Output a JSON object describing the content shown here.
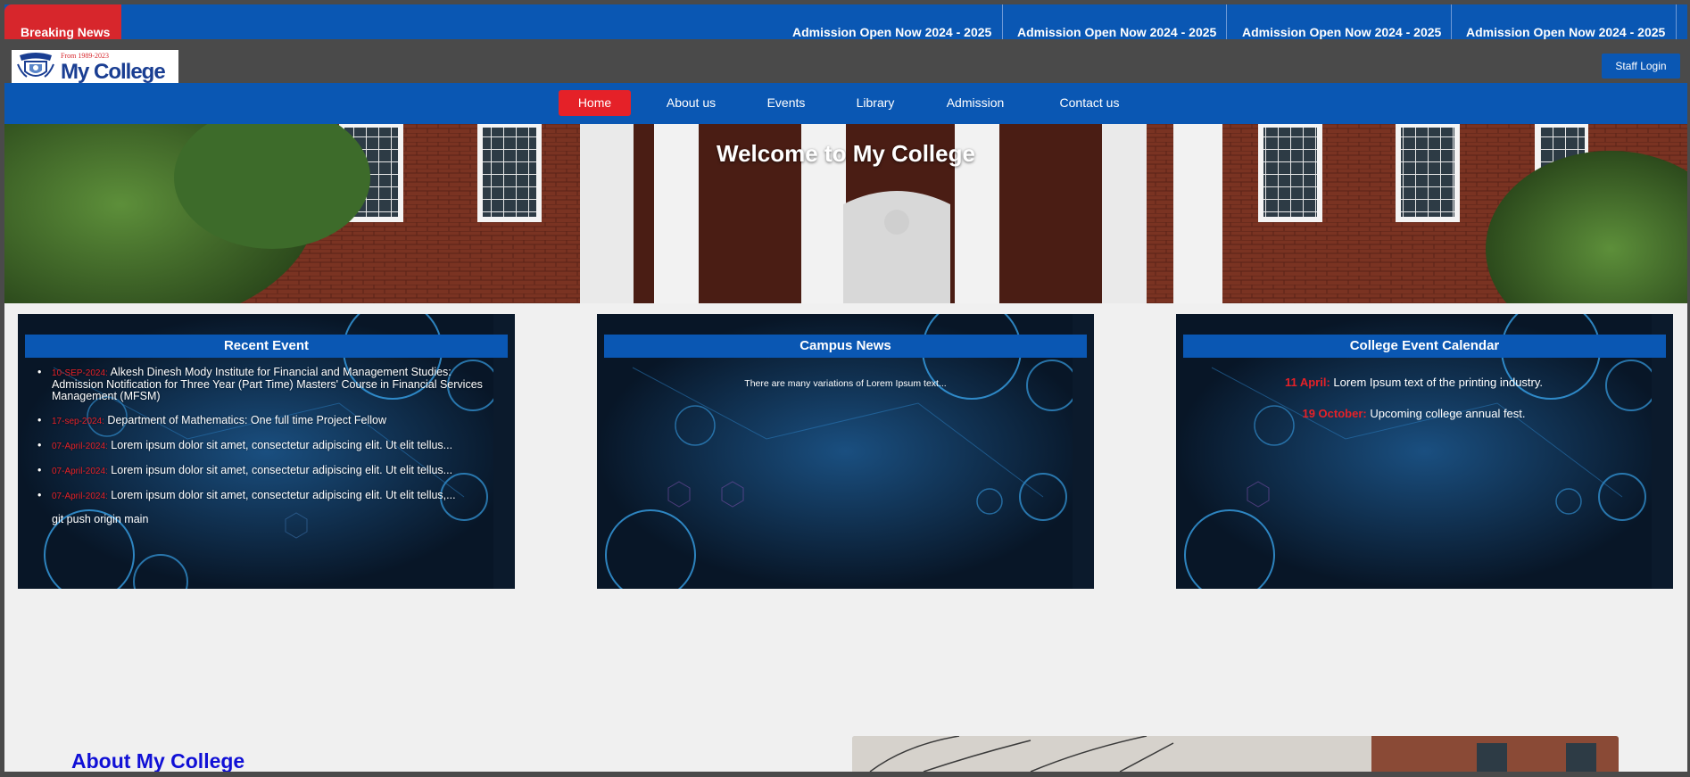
{
  "breaking_news": {
    "label": "Breaking News",
    "items": [
      "Admission Open Now 2024 - 2025",
      "Admission Open Now 2024 - 2025",
      "Admission Open Now 2024 - 2025",
      "Admission Open Now 2024 - 2025"
    ]
  },
  "header": {
    "logo_since": "From 1989-2023",
    "logo_name": "My College",
    "staff_login": "Staff Login"
  },
  "nav": {
    "items": [
      "Home",
      "About us",
      "Events",
      "Library",
      "Admission",
      "Contact us"
    ],
    "active": "Home"
  },
  "hero": {
    "title": "Welcome to My College"
  },
  "recent_event": {
    "title": "Recent Event",
    "items": [
      {
        "date": "10-SEP-2024:",
        "text": "Alkesh Dinesh Mody Institute for Financial and Management Studies: Admission Notification for Three Year (Part Time) Masters' Course in Financial Services Management (MFSM)"
      },
      {
        "date": "17-sep-2024:",
        "text": "Department of Mathematics: One full time Project Fellow"
      },
      {
        "date": "07-April-2024:",
        "text": "Lorem ipsum dolor sit amet, consectetur adipiscing elit. Ut elit tellus..."
      },
      {
        "date": "07-April-2024:",
        "text": "Lorem ipsum dolor sit amet, consectetur adipiscing elit. Ut elit tellus..."
      },
      {
        "date": "07-April-2024:",
        "text": "Lorem ipsum dolor sit amet, consectetur adipiscing elit. Ut elit tellus,..."
      }
    ],
    "extra_line": "git push origin main"
  },
  "campus_news": {
    "title": "Campus News",
    "text": "There are many variations of Lorem Ipsum text..."
  },
  "calendar": {
    "title": "College Event Calendar",
    "items": [
      {
        "date": "11 April:",
        "text": "Lorem Ipsum text of the printing industry."
      },
      {
        "date": "19 October:",
        "text": "Upcoming college annual fest."
      }
    ]
  },
  "about": {
    "title": "About My College"
  },
  "colors": {
    "primary_blue": "#0a57b3",
    "accent_red": "#e52128",
    "about_title": "#1010d6"
  }
}
